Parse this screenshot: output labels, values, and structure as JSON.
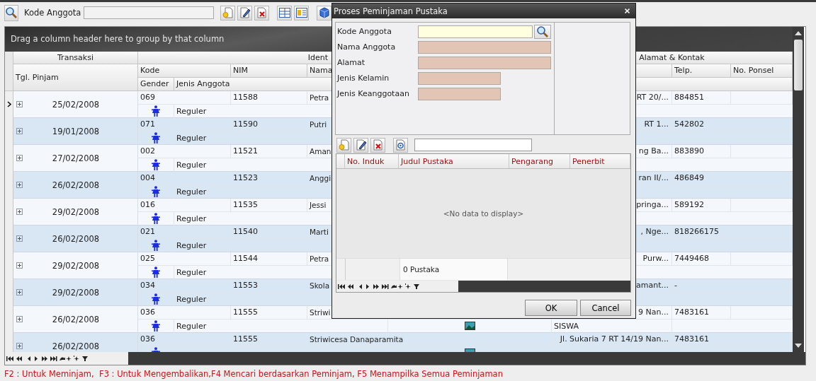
{
  "toolbar": {
    "field_label": "Kode Anggota"
  },
  "grid": {
    "group_panel_hint": "Drag a column header here to group by that column",
    "bands": [
      "Transaksi",
      "Ident",
      "Alamat & Kontak"
    ],
    "columns": {
      "tgl": "Tgl. Pinjam",
      "kode": "Kode",
      "nim": "NIM",
      "nama": "Nama",
      "telp": "Telp.",
      "ponsel": "No. Ponsel",
      "gender": "Gender",
      "jenis": "Jenis Anggota"
    },
    "rows": [
      {
        "selected": true,
        "tgl": "25/02/2008",
        "kode": "069",
        "nim": "11588",
        "nama": "Petra",
        "alamat": "RT 20/...",
        "telp": "884851",
        "female": true,
        "jenis": "Reguler",
        "photo": false
      },
      {
        "selected": false,
        "tgl": "19/01/2008",
        "kode": "071",
        "nim": "11590",
        "nama": "Putri",
        "alamat": "RT 1...",
        "telp": "542802",
        "female": true,
        "jenis": "Reguler",
        "photo": false
      },
      {
        "selected": false,
        "tgl": "27/02/2008",
        "kode": "002",
        "nim": "11521",
        "nama": "Aman",
        "alamat": "ng Ba...",
        "telp": "883890",
        "female": true,
        "jenis": "Reguler",
        "photo": false
      },
      {
        "selected": false,
        "tgl": "26/02/2008",
        "kode": "004",
        "nim": "11523",
        "nama": "Anggi",
        "alamat": "ran II/...",
        "telp": "486849",
        "female": true,
        "jenis": "Reguler",
        "photo": false
      },
      {
        "selected": false,
        "tgl": "29/02/2008",
        "kode": "016",
        "nim": "11535",
        "nama": "Jessi",
        "alamat": "pringa...",
        "telp": "589192",
        "female": true,
        "jenis": "Reguler",
        "photo": false
      },
      {
        "selected": false,
        "tgl": "26/02/2008",
        "kode": "021",
        "nim": "11540",
        "nama": "Marti",
        "alamat": ", Nge...",
        "telp": "818266175",
        "female": true,
        "jenis": "Reguler",
        "photo": false
      },
      {
        "selected": false,
        "tgl": "29/02/2008",
        "kode": "025",
        "nim": "11544",
        "nama": "Petra",
        "alamat": "Purw...",
        "telp": "7449468",
        "female": true,
        "jenis": "Reguler",
        "photo": false
      },
      {
        "selected": false,
        "tgl": "29/02/2008",
        "kode": "034",
        "nim": "11553",
        "nama": "Skola",
        "alamat": "amant...",
        "telp": "-",
        "female": true,
        "jenis": "Reguler",
        "photo": false
      },
      {
        "selected": false,
        "tgl": "26/02/2008",
        "kode": "036",
        "nim": "11555",
        "nama": "Striwi",
        "alamat": "9 Nan...",
        "telp": "7483161",
        "female": true,
        "jenis": "Reguler",
        "photo": true,
        "status": "SISWA"
      },
      {
        "selected": false,
        "tgl": "26/02/2008",
        "kode": "036",
        "nim": "11555",
        "nama": "Striwicesa Danaparamita",
        "alamat": "Jl. Sukaria 7 RT 14/19 Nan...",
        "telp": "7483161",
        "female": true,
        "photo": true
      }
    ]
  },
  "status_bar": "F2 : Untuk Meminjam,  F3 : Untuk Mengembalikan,F4 Mencari berdasarkan Peminjam, F5 Menampilka Semua Peminjaman",
  "dialog": {
    "title": "Proses Peminjaman Pustaka",
    "fields": [
      {
        "label": "Kode Anggota",
        "kind": "lookup"
      },
      {
        "label": "Nama Anggota",
        "kind": "wide"
      },
      {
        "label": "Alamat",
        "kind": "wide"
      },
      {
        "label": "Jenis Kelamin",
        "kind": "short"
      },
      {
        "label": "Jenis Keanggotaan",
        "kind": "short"
      }
    ],
    "book_grid": {
      "columns": [
        "No. Induk",
        "Judul Pustaka",
        "Pengarang",
        "Penerbit"
      ],
      "empty_text": "<No data to display>",
      "summary": "0 Pustaka"
    },
    "buttons": [
      "OK",
      "Cancel"
    ]
  }
}
